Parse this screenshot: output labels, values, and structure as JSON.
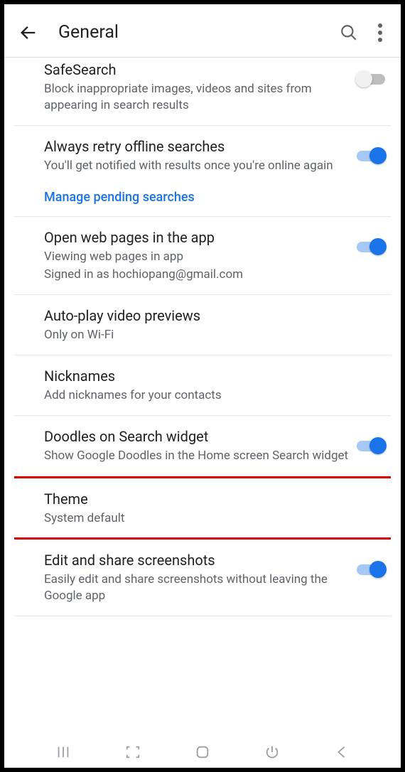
{
  "header": {
    "title": "General"
  },
  "items": {
    "safesearch": {
      "title": "SafeSearch",
      "sub": "Block inappropriate images, videos and sites from appearing in search results"
    },
    "retry": {
      "title": "Always retry offline searches",
      "sub": "You'll get notified with results once you're online again",
      "link": "Manage pending searches"
    },
    "openweb": {
      "title": "Open web pages in the app",
      "sub1": "Viewing web pages in app",
      "sub2": "Signed in as hochiopang@gmail.com"
    },
    "autoplay": {
      "title": "Auto-play video previews",
      "sub": "Only on Wi-Fi"
    },
    "nicknames": {
      "title": "Nicknames",
      "sub": "Add nicknames for your contacts"
    },
    "doodles": {
      "title": "Doodles on Search widget",
      "sub": "Show Google Doodles in the Home screen Search widget"
    },
    "theme": {
      "title": "Theme",
      "sub": "System default"
    },
    "screenshots": {
      "title": "Edit and share screenshots",
      "sub": "Easily edit and share screenshots without leaving the Google app"
    }
  }
}
